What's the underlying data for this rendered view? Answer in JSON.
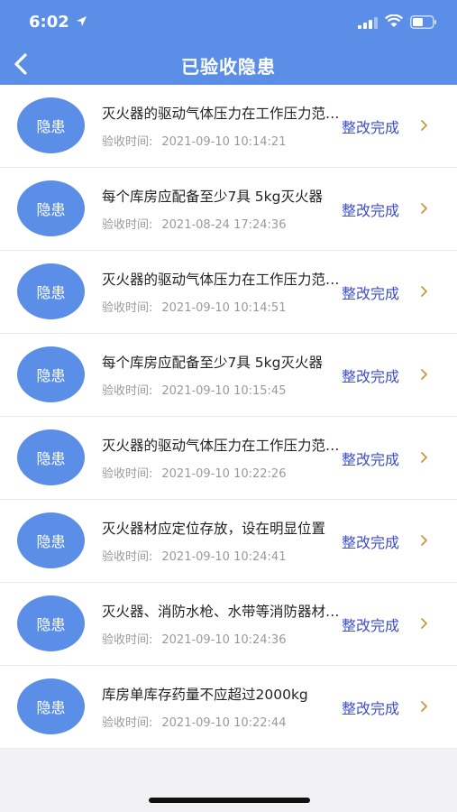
{
  "status_bar": {
    "time": "6:02",
    "icons": [
      "location-arrow-icon",
      "cellular-signal-icon",
      "wifi-icon",
      "battery-icon"
    ]
  },
  "nav": {
    "title": "已验收隐患",
    "back_icon": "chevron-left-icon"
  },
  "colors": {
    "header": "#5b8ee6",
    "avatar": "#5b8ee6",
    "status_text": "#3d4fc9",
    "chevron": "#c79a3a"
  },
  "list": {
    "items": [
      {
        "badge": "隐患",
        "title": "灭火器的驱动气体压力在工作压力范围内",
        "time_label": "验收时间:",
        "time": "2021-09-10 10:14:21",
        "status": "整改完成"
      },
      {
        "badge": "隐患",
        "title": "每个库房应配备至少7具 5kg灭火器",
        "time_label": "验收时间:",
        "time": "2021-08-24 17:24:36",
        "status": "整改完成"
      },
      {
        "badge": "隐患",
        "title": "灭火器的驱动气体压力在工作压力范围内",
        "time_label": "验收时间:",
        "time": "2021-09-10 10:14:51",
        "status": "整改完成"
      },
      {
        "badge": "隐患",
        "title": "每个库房应配备至少7具 5kg灭火器",
        "time_label": "验收时间:",
        "time": "2021-09-10 10:15:45",
        "status": "整改完成"
      },
      {
        "badge": "隐患",
        "title": "灭火器的驱动气体压力在工作压力范围内",
        "time_label": "验收时间:",
        "time": "2021-09-10 10:22:26",
        "status": "整改完成"
      },
      {
        "badge": "隐患",
        "title": "灭火器材应定位存放，设在明显位置",
        "time_label": "验收时间:",
        "time": "2021-09-10 10:24:41",
        "status": "整改完成"
      },
      {
        "badge": "隐患",
        "title": "灭火器、消防水枪、水带等消防器材完好",
        "time_label": "验收时间:",
        "time": "2021-09-10 10:24:36",
        "status": "整改完成"
      },
      {
        "badge": "隐患",
        "title": "库房单库存药量不应超过2000kg",
        "time_label": "验收时间:",
        "time": "2021-09-10 10:22:44",
        "status": "整改完成"
      }
    ]
  }
}
